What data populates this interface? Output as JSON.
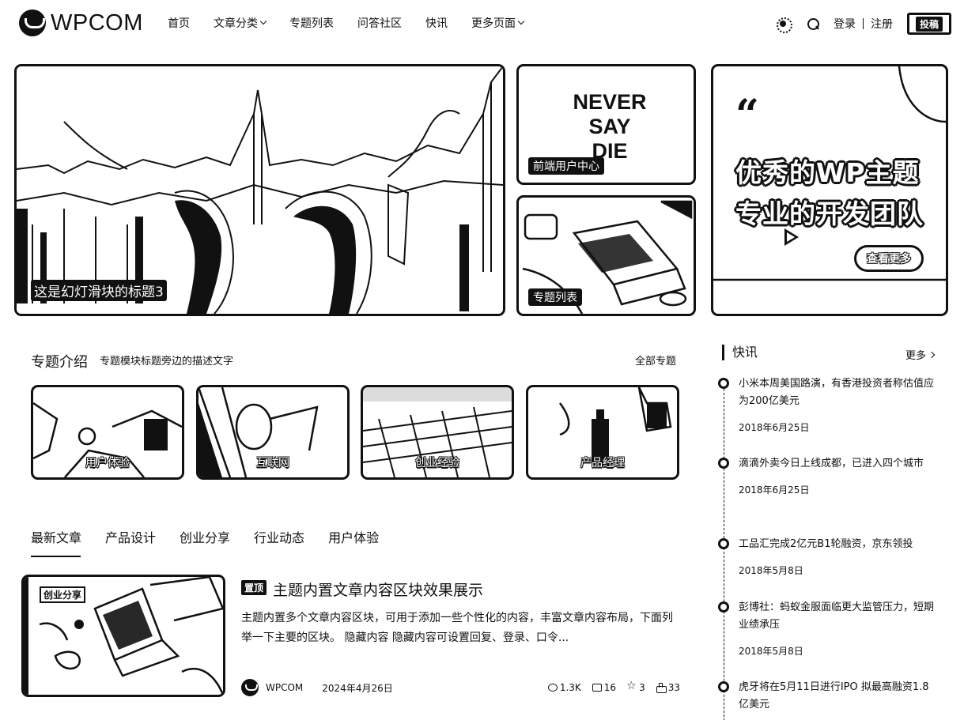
{
  "header": {
    "logo_text": "WPCOM",
    "nav": [
      {
        "label": "首页",
        "dropdown": false
      },
      {
        "label": "文章分类",
        "dropdown": true
      },
      {
        "label": "专题列表",
        "dropdown": false
      },
      {
        "label": "问答社区",
        "dropdown": false
      },
      {
        "label": "快讯",
        "dropdown": false
      },
      {
        "label": "更多页面",
        "dropdown": true
      }
    ],
    "login": "登录",
    "register": "注册",
    "submit": "投稿",
    "icons": [
      "sun-icon",
      "search-icon"
    ]
  },
  "hero": {
    "main_caption": "这是幻灯滑块的标题3",
    "top_caption": "前端用户中心",
    "top_poster_text": [
      "NEVER",
      "SAY",
      "DIE"
    ],
    "bottom_caption": "专题列表",
    "promo": {
      "quote": "“",
      "line1": "优秀的WP主题",
      "line2": "专业的开发团队",
      "button": "查看更多"
    }
  },
  "topics": {
    "title": "专题介绍",
    "description": "专题模块标题旁边的描述文字",
    "more": "全部专题",
    "items": [
      "用户体验",
      "互联网",
      "创业经验",
      "产品经理"
    ]
  },
  "tabs": [
    "最新文章",
    "产品设计",
    "创业分享",
    "行业动态",
    "用户体验"
  ],
  "active_tab": "最新文章",
  "article": {
    "category_tag": "创业分享",
    "pin_label": "置顶",
    "title": "主题内置文章内容区块效果展示",
    "excerpt": "主题内置多个文章内容区块，可用于添加一些个性化的内容，丰富文章内容布局，下面列举一下主要的区块。 隐藏内容 隐藏内容可设置回复、登录、口令...",
    "author": "WPCOM",
    "date": "2024年4月26日",
    "views": "1.3K",
    "comments": "16",
    "stars": "3",
    "likes": "33"
  },
  "news": {
    "title": "快讯",
    "more": "更多",
    "items": [
      {
        "title": "小米本周美国路演，有香港投资者称估值应为200亿美元",
        "date": "2018年6月25日"
      },
      {
        "title": "滴滴外卖今日上线成都，已进入四个城市",
        "date": "2018年6月25日"
      },
      {
        "title": "工品汇完成2亿元B1轮融资，京东领投",
        "date": "2018年5月8日"
      },
      {
        "title": "彭博社：蚂蚁金服面临更大监管压力，短期业绩承压",
        "date": "2018年5月8日"
      },
      {
        "title": "虎牙将在5月11日进行IPO 拟最高融资1.8亿美元",
        "date": ""
      }
    ]
  }
}
